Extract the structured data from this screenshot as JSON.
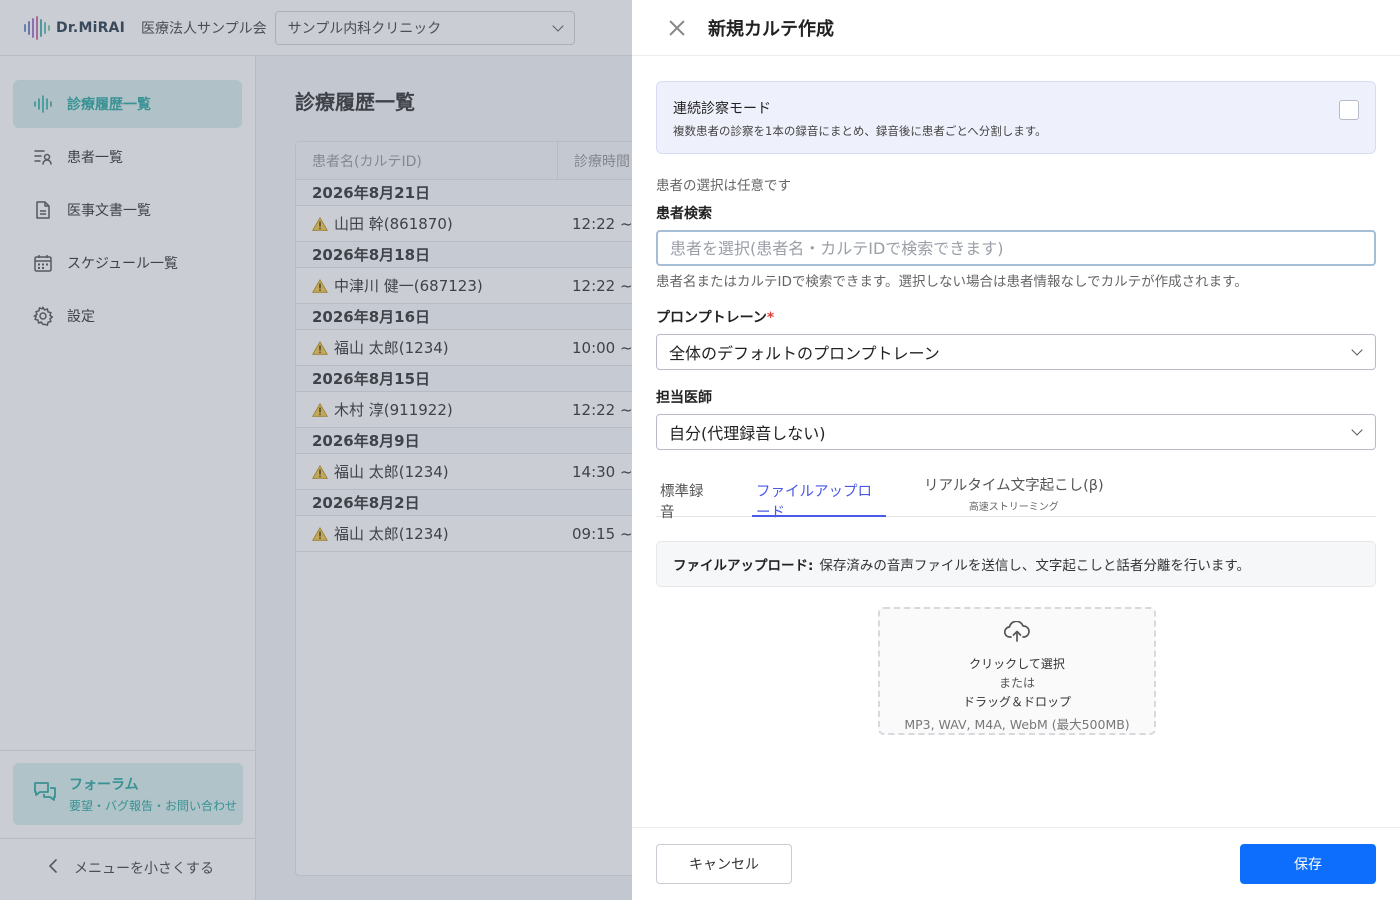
{
  "app": {
    "logo_text": "Dr.MiRAI",
    "org_name": "医療法人サンプル会",
    "clinic_selected": "サンプル内科クリニック",
    "accent_color": "#2aa8a0"
  },
  "sidebar": {
    "items": [
      {
        "label": "診療履歴一覧",
        "icon": "waveform-icon",
        "active": true
      },
      {
        "label": "患者一覧",
        "icon": "patient-list-icon",
        "active": false
      },
      {
        "label": "医事文書一覧",
        "icon": "document-icon",
        "active": false
      },
      {
        "label": "スケジュール一覧",
        "icon": "calendar-icon",
        "active": false
      },
      {
        "label": "設定",
        "icon": "gear-icon",
        "active": false
      }
    ],
    "forum": {
      "title": "フォーラム",
      "subtitle": "要望・バグ報告・お問い合わせ",
      "icon": "chat-icon"
    },
    "collapse_label": "メニューを小さくする"
  },
  "main": {
    "title": "診療履歴一覧",
    "columns": [
      "患者名(カルテID)",
      "診療時間"
    ],
    "groups": [
      {
        "date": "2026年8月21日",
        "rows": [
          {
            "patient": "山田 幹(861870)",
            "time": "12:22 ~"
          }
        ]
      },
      {
        "date": "2026年8月18日",
        "rows": [
          {
            "patient": "中津川 健一(687123)",
            "time": "12:22 ~"
          }
        ]
      },
      {
        "date": "2026年8月16日",
        "rows": [
          {
            "patient": "福山 太郎(1234)",
            "time": "10:00 ~"
          }
        ]
      },
      {
        "date": "2026年8月15日",
        "rows": [
          {
            "patient": "木村 淳(911922)",
            "time": "12:22 ~"
          }
        ]
      },
      {
        "date": "2026年8月9日",
        "rows": [
          {
            "patient": "福山 太郎(1234)",
            "time": "14:30 ~"
          }
        ]
      },
      {
        "date": "2026年8月2日",
        "rows": [
          {
            "patient": "福山 太郎(1234)",
            "time": "09:15 ~"
          }
        ]
      }
    ]
  },
  "drawer": {
    "title": "新規カルテ作成",
    "continuous_mode": {
      "title": "連続診察モード",
      "description": "複数患者の診察を1本の録音にまとめ、録音後に患者ごとへ分割します。",
      "checked": false
    },
    "optional_note": "患者の選択は任意です",
    "patient_search": {
      "label": "患者検索",
      "placeholder": "患者を選択(患者名・カルテIDで検索できます)",
      "value": "",
      "hint": "患者名またはカルテIDで検索できます。選択しない場合は患者情報なしでカルテが作成されます。"
    },
    "prompt_train": {
      "label": "プロンプトレーン",
      "required_mark": "*",
      "value": "全体のデフォルトのプロンプトレーン"
    },
    "doctor": {
      "label": "担当医師",
      "value": "自分(代理録音しない)"
    },
    "tabs": [
      {
        "label": "標準録音",
        "sub": ""
      },
      {
        "label": "ファイルアップロード",
        "sub": "",
        "active": true
      },
      {
        "label": "リアルタイム文字起こし(β)",
        "sub": "高速ストリーミング"
      }
    ],
    "info": {
      "bold": "ファイルアップロード:",
      "text": "保存済みの音声ファイルを送信し、文字起こしと話者分離を行います。"
    },
    "dropzone": {
      "line1": "クリックして選択",
      "line2": "または",
      "line3": "ドラッグ＆ドロップ",
      "formats": "MP3, WAV, M4A, WebM (最大500MB)",
      "icon": "cloud-upload-icon"
    },
    "cancel_label": "キャンセル",
    "save_label": "保存",
    "save_color": "#0d6efd"
  }
}
